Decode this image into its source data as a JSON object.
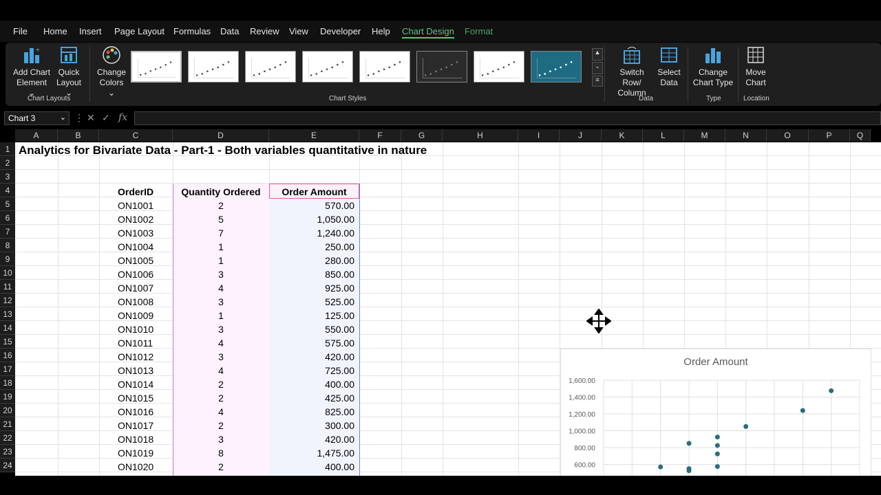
{
  "menu": [
    "File",
    "Home",
    "Insert",
    "Page Layout",
    "Formulas",
    "Data",
    "Review",
    "View",
    "Developer",
    "Help",
    "Chart Design",
    "Format"
  ],
  "ribbon": {
    "add_chart_element": [
      "Add Chart",
      "Element ⌄"
    ],
    "quick_layout": [
      "Quick",
      "Layout ⌄"
    ],
    "change_colors": [
      "Change",
      "Colors ⌄"
    ],
    "switch_row_column": [
      "Switch Row/",
      "Column"
    ],
    "select_data": [
      "Select",
      "Data"
    ],
    "change_chart_type": [
      "Change",
      "Chart Type"
    ],
    "move_chart": [
      "Move",
      "Chart"
    ],
    "groups": {
      "chart_layouts": "Chart Layouts",
      "chart_styles": "Chart Styles",
      "data": "Data",
      "type": "Type",
      "location": "Location"
    }
  },
  "namebox": "Chart 3",
  "formula": "",
  "columns": [
    "A",
    "B",
    "C",
    "D",
    "E",
    "F",
    "G",
    "H",
    "I",
    "J",
    "K",
    "L",
    "M",
    "N",
    "O",
    "P",
    "Q"
  ],
  "rows": [
    "1",
    "2",
    "3",
    "4",
    "5",
    "6",
    "7",
    "8",
    "9",
    "10",
    "11",
    "12",
    "13",
    "14",
    "15",
    "16",
    "17",
    "18",
    "19",
    "20",
    "21",
    "22",
    "23",
    "24"
  ],
  "sheet": {
    "title": "Analytics for Bivariate Data - Part-1 - Both variables quantitative in nature",
    "headers": {
      "order_id": "OrderID",
      "qty": "Quantity Ordered",
      "amount": "Order Amount"
    },
    "table": [
      [
        "ON1001",
        "2",
        "570.00"
      ],
      [
        "ON1002",
        "5",
        "1,050.00"
      ],
      [
        "ON1003",
        "7",
        "1,240.00"
      ],
      [
        "ON1004",
        "1",
        "250.00"
      ],
      [
        "ON1005",
        "1",
        "280.00"
      ],
      [
        "ON1006",
        "3",
        "850.00"
      ],
      [
        "ON1007",
        "4",
        "925.00"
      ],
      [
        "ON1008",
        "3",
        "525.00"
      ],
      [
        "ON1009",
        "1",
        "125.00"
      ],
      [
        "ON1010",
        "3",
        "550.00"
      ],
      [
        "ON1011",
        "4",
        "575.00"
      ],
      [
        "ON1012",
        "3",
        "420.00"
      ],
      [
        "ON1013",
        "4",
        "725.00"
      ],
      [
        "ON1014",
        "2",
        "400.00"
      ],
      [
        "ON1015",
        "2",
        "425.00"
      ],
      [
        "ON1016",
        "4",
        "825.00"
      ],
      [
        "ON1017",
        "2",
        "300.00"
      ],
      [
        "ON1018",
        "3",
        "420.00"
      ],
      [
        "ON1019",
        "8",
        "1,475.00"
      ],
      [
        "ON1020",
        "2",
        "400.00"
      ]
    ]
  },
  "chart_data": {
    "type": "scatter",
    "title": "Order Amount",
    "y_ticks": [
      "1,600.00",
      "1,400.00",
      "1,200.00",
      "1,000.00",
      "800.00",
      "600.00"
    ],
    "ylim": [
      600,
      1600
    ],
    "xlim": [
      0,
      9
    ],
    "grid": true,
    "color": "#2a6e7e",
    "points": [
      {
        "x": 2,
        "y": 570
      },
      {
        "x": 5,
        "y": 1050
      },
      {
        "x": 7,
        "y": 1240
      },
      {
        "x": 3,
        "y": 850
      },
      {
        "x": 4,
        "y": 925
      },
      {
        "x": 3,
        "y": 525
      },
      {
        "x": 3,
        "y": 550
      },
      {
        "x": 4,
        "y": 575
      },
      {
        "x": 4,
        "y": 725
      },
      {
        "x": 4,
        "y": 825
      },
      {
        "x": 8,
        "y": 1475
      }
    ]
  }
}
